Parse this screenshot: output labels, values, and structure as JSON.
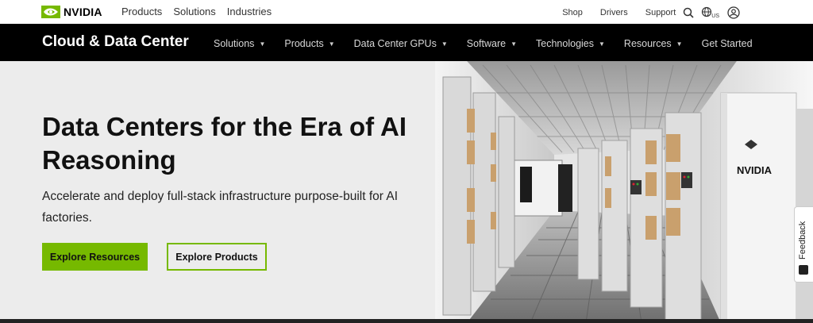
{
  "topbar": {
    "logo_text": "NVIDIA",
    "nav": [
      "Products",
      "Solutions",
      "Industries"
    ],
    "links": [
      "Shop",
      "Drivers",
      "Support"
    ],
    "region": "US"
  },
  "subnav": {
    "brand": "Cloud & Data Center",
    "items": [
      {
        "label": "Solutions",
        "dropdown": true
      },
      {
        "label": "Products",
        "dropdown": true
      },
      {
        "label": "Data Center GPUs",
        "dropdown": true
      },
      {
        "label": "Software",
        "dropdown": true
      },
      {
        "label": "Technologies",
        "dropdown": true
      },
      {
        "label": "Resources",
        "dropdown": true
      },
      {
        "label": "Get Started",
        "dropdown": false
      }
    ]
  },
  "hero": {
    "headline": "Data Centers for the Era of AI Reasoning",
    "subtext": "Accelerate and deploy full-stack infrastructure purpose-built for AI factories.",
    "primary_button": "Explore Resources",
    "secondary_button": "Explore Products",
    "image_logo_text": "NVIDIA"
  },
  "feedback": {
    "label": "Feedback"
  },
  "colors": {
    "accent": "#76b900",
    "nav_bg": "#000000",
    "hero_bg": "#ececec"
  }
}
